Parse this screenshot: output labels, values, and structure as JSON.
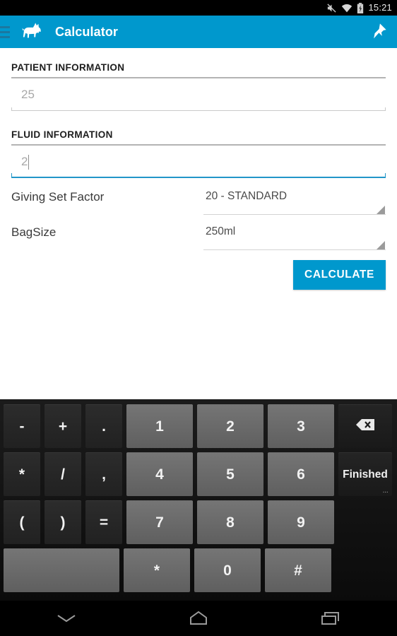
{
  "statusbar": {
    "time": "15:21",
    "icons": [
      "mute-icon",
      "wifi-icon",
      "battery-charging-icon"
    ]
  },
  "appbar": {
    "menu_icon": "hamburger-menu-icon",
    "logo_icon": "dog-logo-icon",
    "title": "Calculator",
    "action_icon": "pin-icon",
    "color": "#0098cd"
  },
  "form": {
    "patient_section": {
      "header": "PATIENT INFORMATION",
      "weight_field": {
        "value": "25",
        "placeholder": "25"
      }
    },
    "fluid_section": {
      "header": "FLUID INFORMATION",
      "rate_field": {
        "value": "2",
        "placeholder": "2"
      },
      "giving_set_factor": {
        "label": "Giving Set Factor",
        "value": "20 - STANDARD"
      },
      "bag_size": {
        "label": "BagSize",
        "value": "250ml"
      }
    },
    "calculate_button": "CALCULATE"
  },
  "keyboard": {
    "rows": [
      [
        {
          "label": "-",
          "name": "key-minus",
          "style": "op dark"
        },
        {
          "label": "+",
          "name": "key-plus",
          "style": "op dark"
        },
        {
          "label": ".",
          "name": "key-period",
          "style": "op dark"
        },
        {
          "label": "1",
          "name": "key-1",
          "style": "num light"
        },
        {
          "label": "2",
          "name": "key-2",
          "style": "num light"
        },
        {
          "label": "3",
          "name": "key-3",
          "style": "num light"
        },
        {
          "label": "",
          "name": "key-backspace",
          "style": "side func",
          "icon": "backspace-icon"
        }
      ],
      [
        {
          "label": "*",
          "name": "key-asterisk",
          "style": "op dark"
        },
        {
          "label": "/",
          "name": "key-slash",
          "style": "op dark"
        },
        {
          "label": ",",
          "name": "key-comma",
          "style": "op dark"
        },
        {
          "label": "4",
          "name": "key-4",
          "style": "num light"
        },
        {
          "label": "5",
          "name": "key-5",
          "style": "num light"
        },
        {
          "label": "6",
          "name": "key-6",
          "style": "num light"
        },
        {
          "label": "Finished",
          "name": "key-finished",
          "style": "side func",
          "small": true,
          "dots": "..."
        }
      ],
      [
        {
          "label": "(",
          "name": "key-paren-open",
          "style": "op dark"
        },
        {
          "label": ")",
          "name": "key-paren-close",
          "style": "op dark"
        },
        {
          "label": "=",
          "name": "key-equals",
          "style": "op dark"
        },
        {
          "label": "7",
          "name": "key-7",
          "style": "num light"
        },
        {
          "label": "8",
          "name": "key-8",
          "style": "num light"
        },
        {
          "label": "9",
          "name": "key-9",
          "style": "num light"
        },
        {
          "label": "",
          "name": "key-spacer",
          "style": "side empty"
        }
      ],
      [
        {
          "label": "",
          "name": "key-space",
          "style": "wide light"
        },
        {
          "label": "*",
          "name": "key-star",
          "style": "num light"
        },
        {
          "label": "0",
          "name": "key-0",
          "style": "num light"
        },
        {
          "label": "#",
          "name": "key-hash",
          "style": "num light"
        },
        {
          "label": "",
          "name": "key-spacer-2",
          "style": "side empty"
        }
      ]
    ]
  },
  "navbar": {
    "back_icon": "collapse-keyboard-icon",
    "home_icon": "home-icon",
    "recents_icon": "recent-apps-icon"
  }
}
